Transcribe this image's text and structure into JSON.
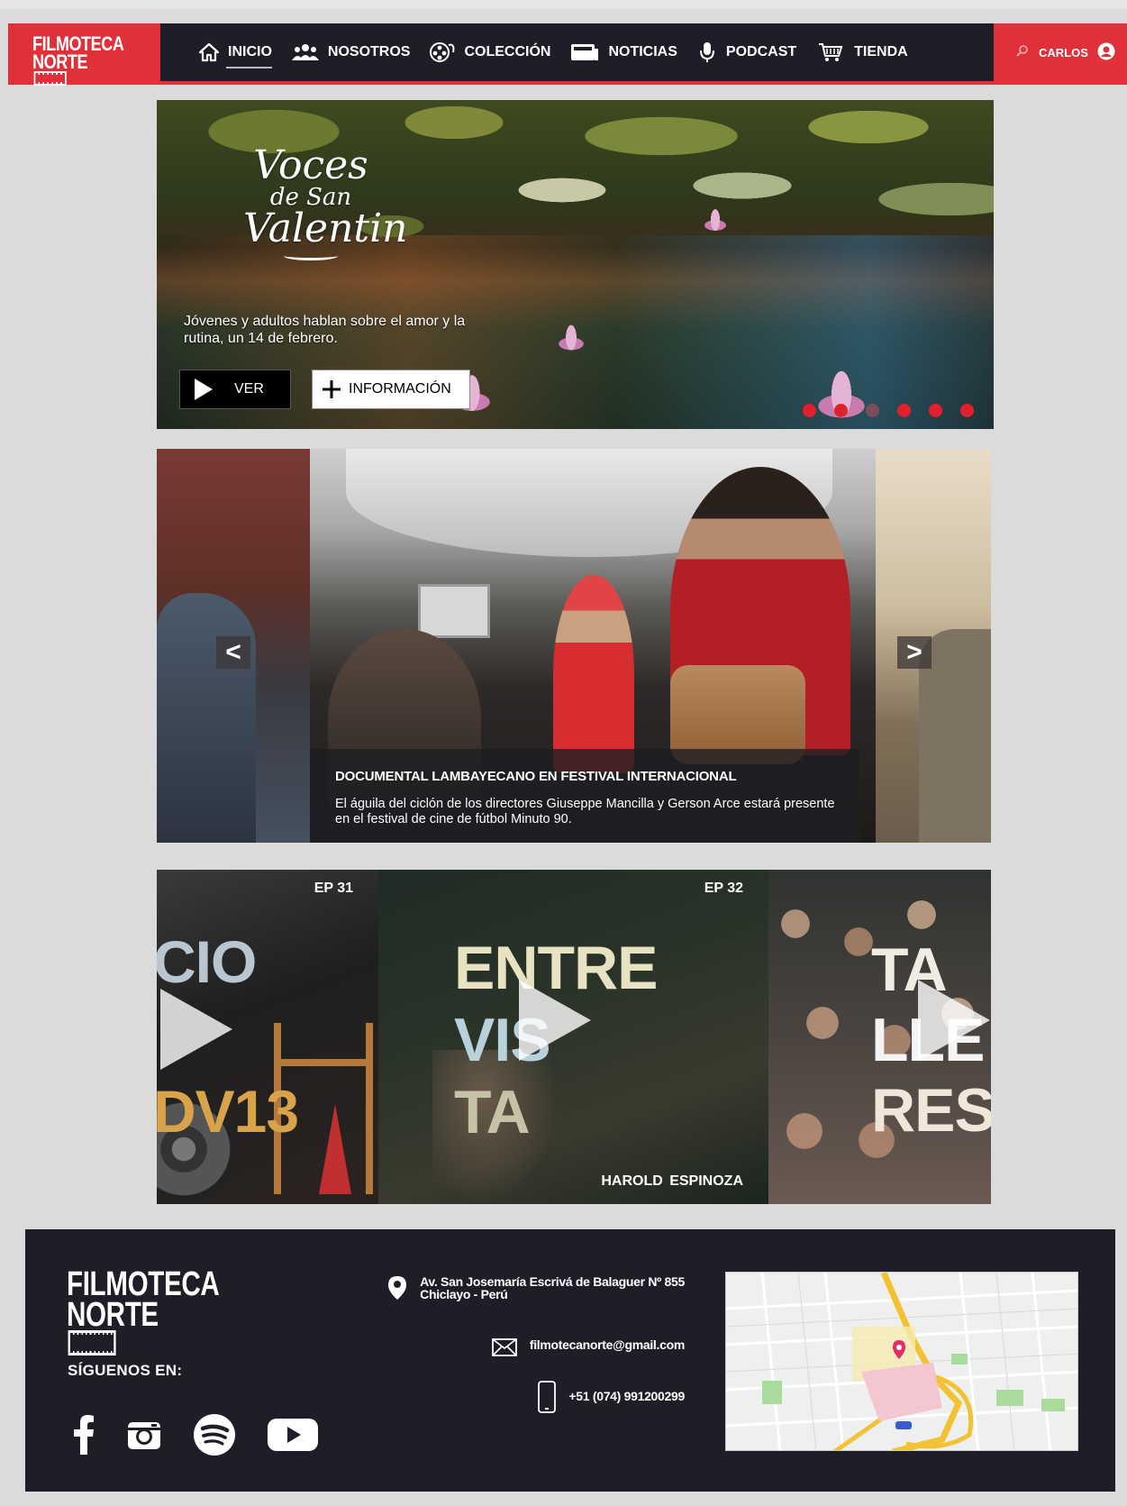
{
  "header": {
    "logo_line1": "FILMOTECA",
    "logo_line2": "NORTE",
    "nav": [
      {
        "label": "INICIO",
        "icon": "home-icon",
        "active": true
      },
      {
        "label": "NOSOTROS",
        "icon": "people-icon"
      },
      {
        "label": "COLECCIÓN",
        "icon": "film-reel-icon"
      },
      {
        "label": "NOTICIAS",
        "icon": "newspaper-icon"
      },
      {
        "label": "PODCAST",
        "icon": "microphone-icon"
      },
      {
        "label": "TIENDA",
        "icon": "cart-icon"
      }
    ],
    "user_name": "CARLOS",
    "colors": {
      "brand": "#e0303a",
      "dark": "#1e1e28"
    }
  },
  "hero": {
    "title_line1": "Voces",
    "title_line2": "de San",
    "title_line3": "Valentin",
    "description": "Jóvenes y adultos hablan sobre el amor y la rutina, un 14 de febrero.",
    "watch_label": "VER",
    "info_label": "INFORMACIÓN",
    "slide_count": 6,
    "active_slide": 1
  },
  "news": {
    "headline": "DOCUMENTAL LAMBAYECANO EN FESTIVAL INTERNACIONAL",
    "summary": "El águila del ciclón de los directores Giuseppe Mancilla y Gerson Arce estará presente en el festival de cine de fútbol Minuto 90.",
    "prev_label": "<",
    "next_label": ">"
  },
  "podcast": {
    "episodes": [
      {
        "ep": "EP 31",
        "word_top": "CIO",
        "word_bottom": "DV13"
      },
      {
        "ep": "EP 32",
        "word_lines": [
          "ENTRE",
          "VIS",
          "TA"
        ],
        "guest": "HAROLD  ESPINOZA"
      },
      {
        "word_lines": [
          "TA",
          "LLE",
          "RES"
        ]
      }
    ]
  },
  "footer": {
    "logo_line1": "FILMOTECA",
    "logo_line2": "NORTE",
    "follow_label": "SÍGUENOS EN:",
    "address_line1": "Av. San Josemaría Escrivá de Balaguer Nº 855",
    "address_line2": "Chiclayo - Perú",
    "email": "filmotecanorte@gmail.com",
    "phone": "+51 (074) 991200299",
    "socials": [
      "facebook-icon",
      "instagram-icon",
      "spotify-icon",
      "youtube-icon"
    ]
  }
}
